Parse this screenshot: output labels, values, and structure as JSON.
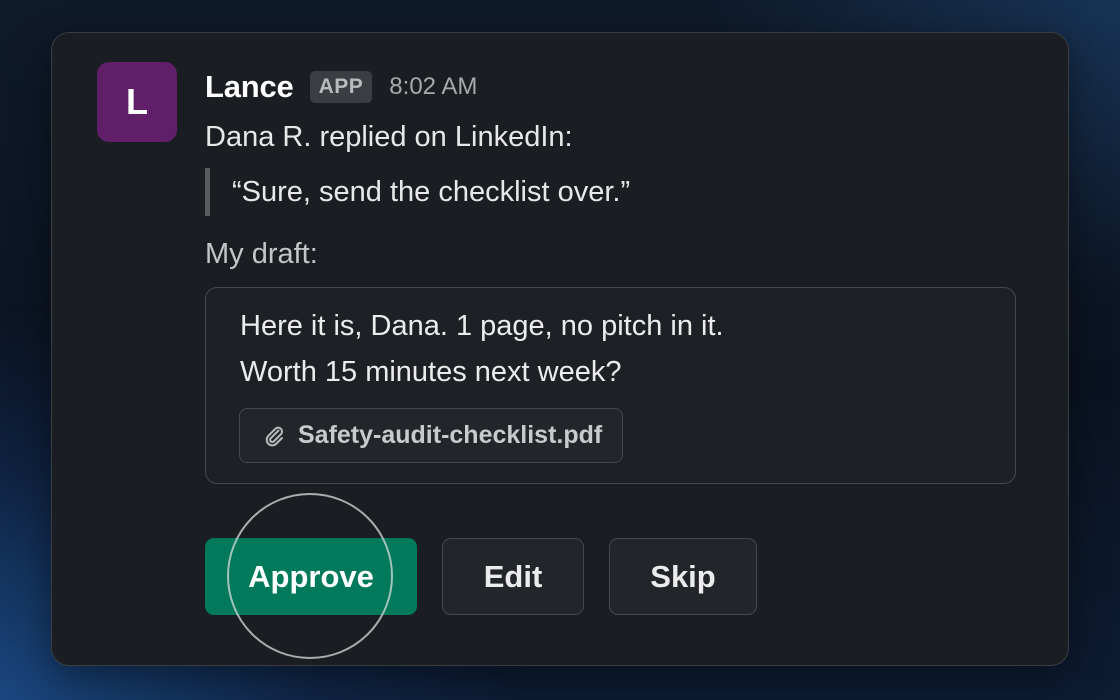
{
  "message": {
    "avatar_initial": "L",
    "avatar_color": "#611f69",
    "sender": "Lance",
    "badge": "APP",
    "timestamp": "8:02 AM",
    "intro": "Dana R. replied on LinkedIn:",
    "quote": "“Sure, send the checklist over.”",
    "draft_label": "My draft:",
    "draft": {
      "line1": "Here it is, Dana. 1 page, no pitch in it.",
      "line2": "Worth 15 minutes next week?",
      "attachment": {
        "icon": "paperclip-icon",
        "filename": "Safety-audit-checklist.pdf"
      }
    }
  },
  "actions": {
    "approve_label": "Approve",
    "edit_label": "Edit",
    "skip_label": "Skip"
  },
  "colors": {
    "approve": "#007a5a",
    "card_bg": "#1a1d21"
  }
}
